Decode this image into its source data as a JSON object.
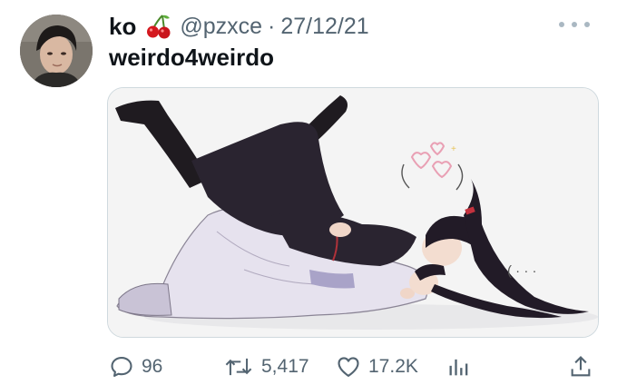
{
  "tweet": {
    "author": {
      "display_name": "ko",
      "emoji_icon": "cherries-emoji-icon",
      "handle": "@pzxce",
      "date": "27/12/21"
    },
    "separator": "·",
    "text": "weirdo4weirdo",
    "media": {
      "type": "illustration",
      "doodle_text": "( · · ·"
    },
    "actions": {
      "replies": "96",
      "retweets": "5,417",
      "likes": "17.2K"
    },
    "colors": {
      "text_primary": "#0f1419",
      "text_secondary": "#536471",
      "border": "#cfd9de",
      "icon": "#536471"
    }
  }
}
